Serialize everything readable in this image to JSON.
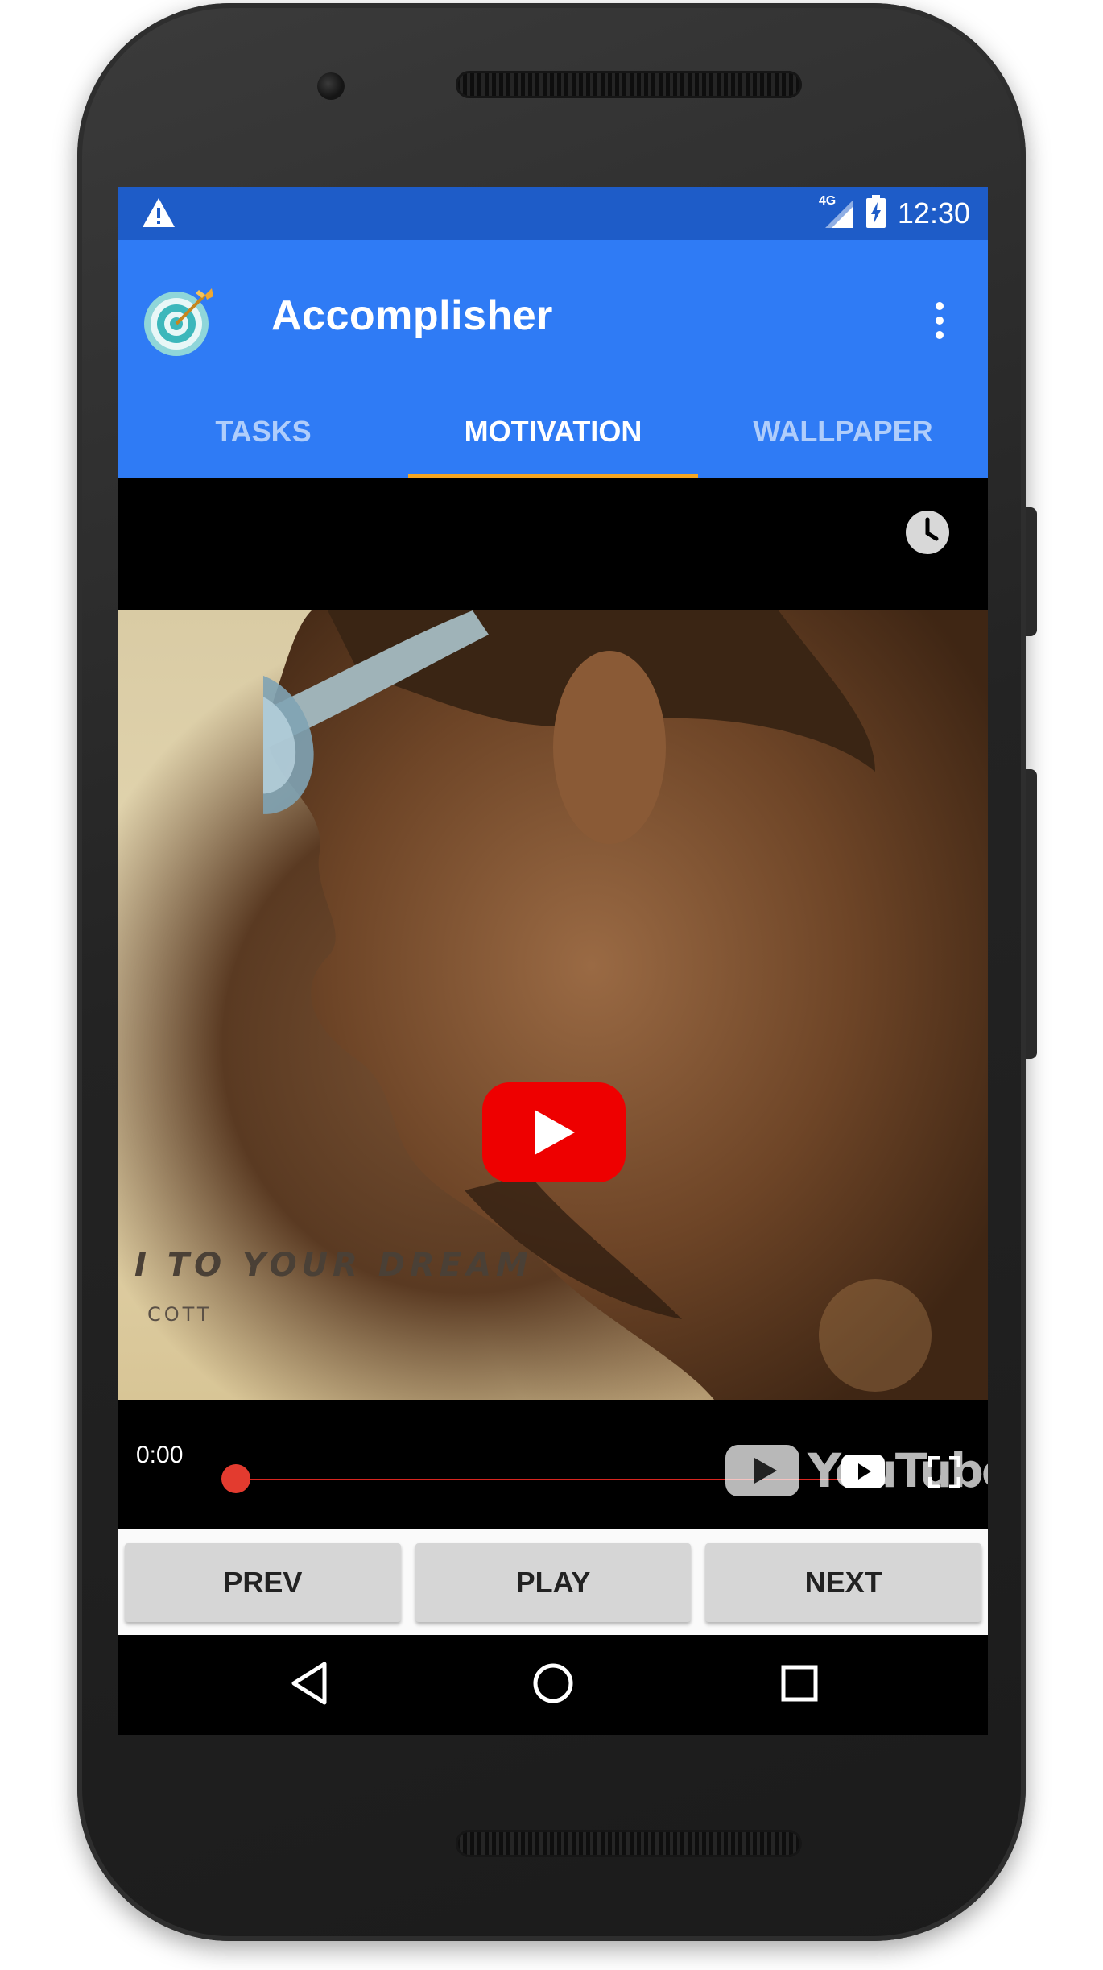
{
  "status_bar": {
    "network": "4G",
    "time": "12:30",
    "icons": [
      "warning-icon",
      "signal-icon",
      "battery-charging-icon"
    ]
  },
  "app_bar": {
    "title": "Accomplisher",
    "logo": "target-logo-icon",
    "menu_icon": "overflow-menu-icon"
  },
  "tabs": [
    {
      "label": "TASKS",
      "active": false
    },
    {
      "label": "MOTIVATION",
      "active": true
    },
    {
      "label": "WALLPAPER",
      "active": false
    }
  ],
  "video": {
    "caption_line1": "I TO YOUR DREAM",
    "caption_line2": "COTT",
    "current_time": "0:00",
    "progress": 0,
    "logo_text": "YouTube"
  },
  "buttons": {
    "prev": "PREV",
    "play": "PLAY",
    "next": "NEXT"
  },
  "colors": {
    "status_bar": "#1e5cc8",
    "app_bar": "#2f7bf5",
    "tab_indicator": "#f5a623",
    "youtube_red": "#ee0000",
    "progress": "#e33b2f"
  }
}
